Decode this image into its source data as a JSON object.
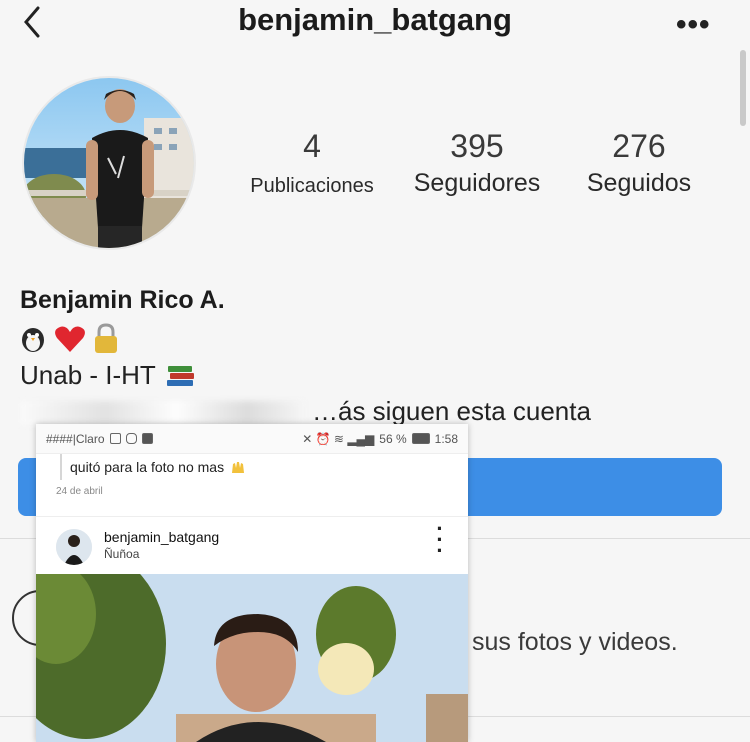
{
  "header": {
    "username": "benjamin_batgang"
  },
  "stats": {
    "posts": {
      "value": "4",
      "label": "Publicaciones"
    },
    "followers": {
      "value": "395",
      "label": "Seguidores"
    },
    "following": {
      "value": "276",
      "label": "Seguidos"
    }
  },
  "bio": {
    "full_name": "Benjamin Rico A.",
    "emoji_icons": [
      "penguin-icon",
      "heart-icon",
      "lock-icon"
    ],
    "line": "Unab - I-HT",
    "line_icon": "books-icon",
    "followed_by_visible": "…ás siguen esta cuenta"
  },
  "private_notice": "sus fotos y videos.",
  "overlay": {
    "status_left": "####|Claro",
    "battery": "56 %",
    "time": "1:58",
    "caption": "quitó para la foto no mas",
    "date": "24 de abril",
    "post_username": "benjamin_batgang",
    "post_location": "Ñuñoa"
  },
  "colors": {
    "follow_button": "#3d8ee6",
    "heart": "#e0262f",
    "background": "#f6f6f6"
  }
}
